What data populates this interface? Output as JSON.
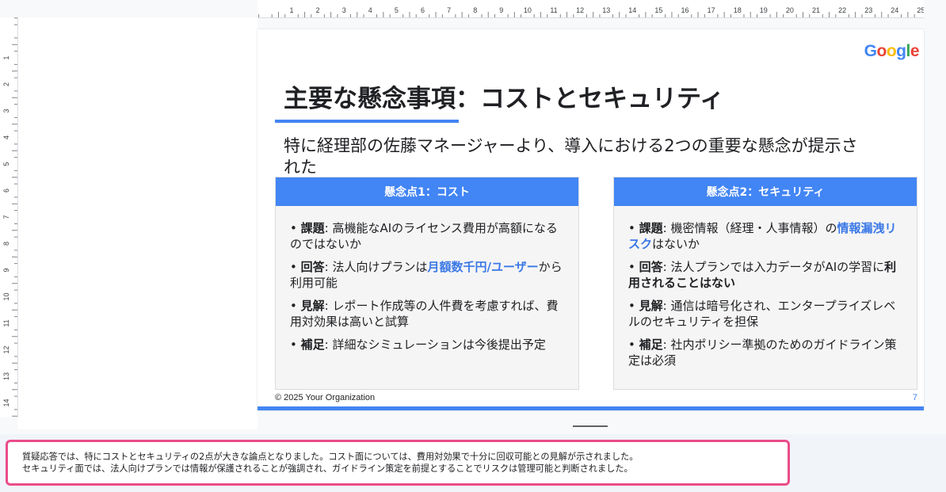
{
  "ruler": {
    "top_numbers": [
      "1",
      "2",
      "3",
      "4",
      "5",
      "6",
      "7",
      "8",
      "9",
      "10",
      "11",
      "12",
      "13",
      "14",
      "15",
      "16",
      "17",
      "18",
      "19",
      "20",
      "21",
      "22",
      "23",
      "24",
      "25"
    ],
    "left_numbers": [
      "1",
      "2",
      "3",
      "4",
      "5",
      "6",
      "7",
      "8",
      "9",
      "10",
      "11",
      "12",
      "13",
      "14"
    ]
  },
  "slide": {
    "logo": [
      "G",
      "o",
      "o",
      "g",
      "l",
      "e"
    ],
    "logo_colors": [
      "#4285F4",
      "#EA4335",
      "#FBBC05",
      "#4285F4",
      "#34A853",
      "#EA4335"
    ],
    "title": "主要な懸念事項：コストとセキュリティ",
    "subtitle": "特に経理部の佐藤マネージャーより、導入における2つの重要な懸念が提示された",
    "card1": {
      "header": "懸念点1：コスト",
      "items": [
        {
          "key": "課題",
          "text": ": 高機能なAIのライセンス費用が高額になるのではないか"
        },
        {
          "key": "回答",
          "pre": ": 法人向けプランは",
          "highlight": "月額数千円/ユーザー",
          "post": "から利用可能"
        },
        {
          "key": "見解",
          "text": ": レポート作成等の人件費を考慮すれば、費用対効果は高いと試算"
        },
        {
          "key": "補足",
          "text": ": 詳細なシミュレーションは今後提出予定"
        }
      ]
    },
    "card2": {
      "header": "懸念点2：セキュリティ",
      "items": [
        {
          "key": "課題",
          "pre": ": 機密情報（経理・人事情報）の",
          "highlight": "情報漏洩リスク",
          "post": "はないか"
        },
        {
          "key": "回答",
          "pre": ": 法人プランでは入力データがAIの学習に",
          "bold": "利用されることはない"
        },
        {
          "key": "見解",
          "text": ": 通信は暗号化され、エンタープライズレベルのセキュリティを担保"
        },
        {
          "key": "補足",
          "text": ": 社内ポリシー準拠のためのガイドライン策定は必須"
        }
      ]
    },
    "footer_left": "© 2025 Your Organization",
    "page_number": "7",
    "accent_color": "#4285f4"
  },
  "notes": {
    "line1": "質疑応答では、特にコストとセキュリティの2点が大きな論点となりました。コスト面については、費用対効果で十分に回収可能との見解が示されました。",
    "line2": "セキュリティ面では、法人向けプランでは情報が保護されることが強調され、ガイドライン策定を前提とすることでリスクは管理可能と判断されました。"
  }
}
